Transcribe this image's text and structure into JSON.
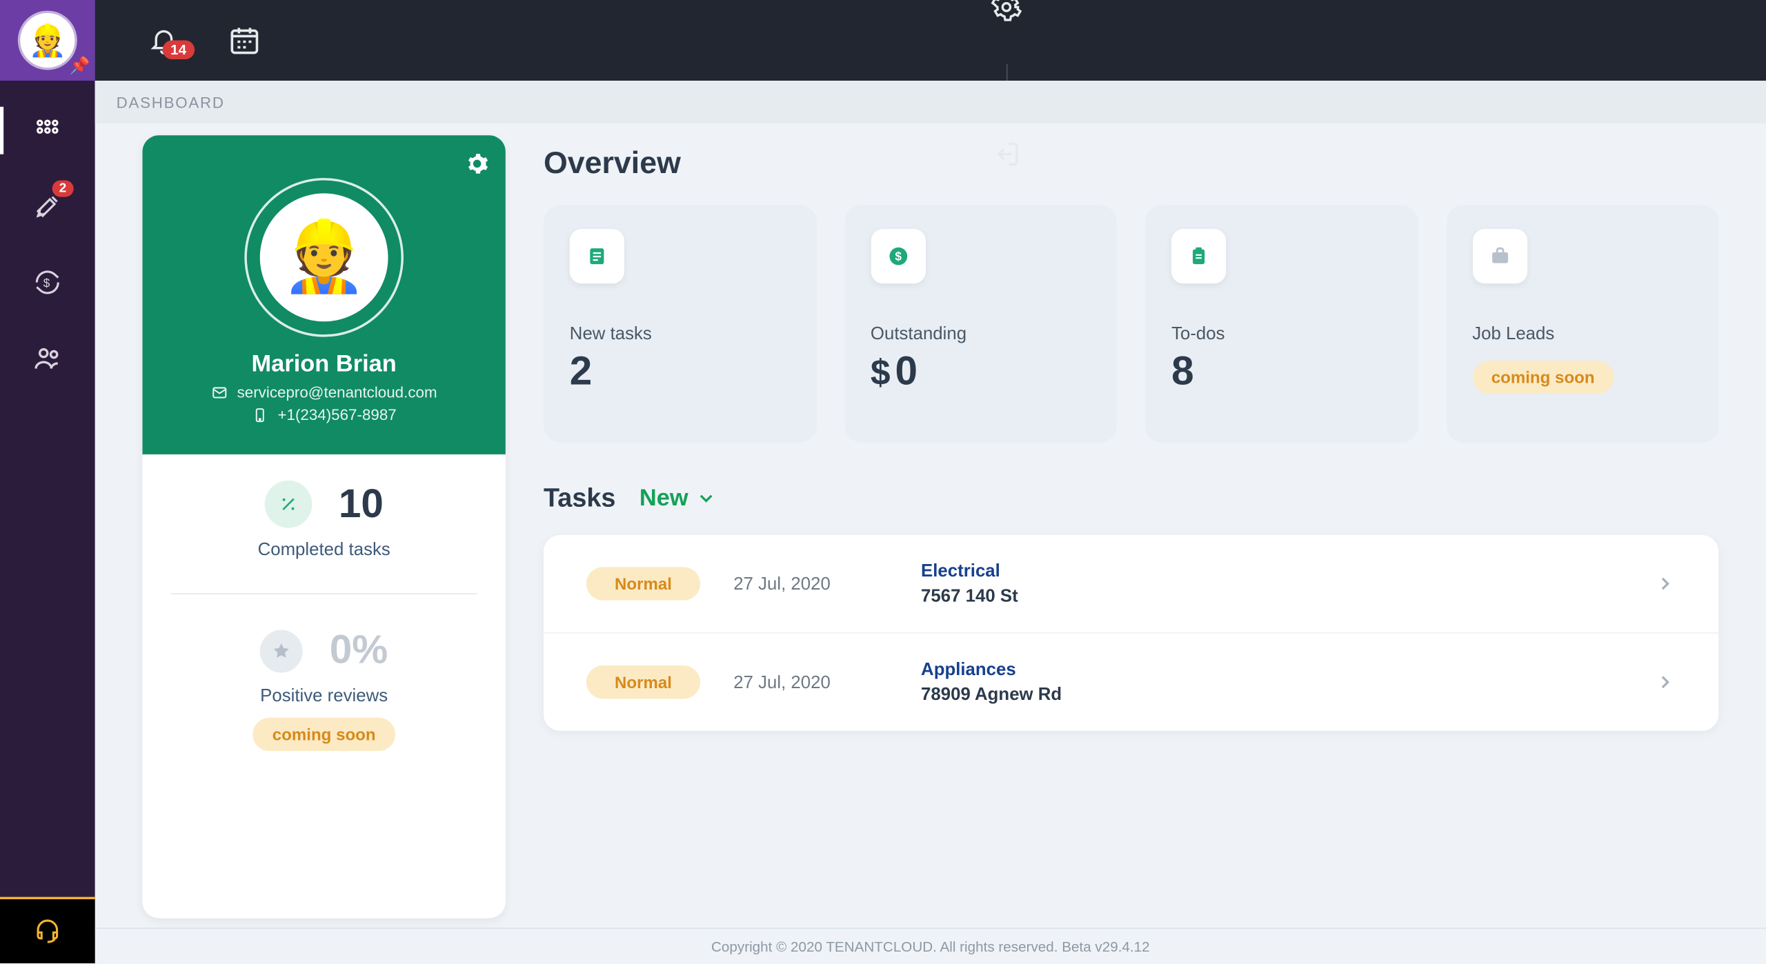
{
  "breadcrumb": "DASHBOARD",
  "header": {
    "notification_count": "14"
  },
  "side_nav": {
    "tools_badge": "2"
  },
  "profile": {
    "name": "Marion Brian",
    "email": "servicepro@tenantcloud.com",
    "phone": "+1(234)567-8987",
    "completed_count": "10",
    "completed_label": "Completed tasks",
    "reviews_percent": "0%",
    "reviews_label": "Positive reviews",
    "reviews_soon": "coming soon"
  },
  "overview": {
    "title": "Overview",
    "cards": [
      {
        "label": "New tasks",
        "value": "2",
        "icon": "note-icon"
      },
      {
        "label": "Outstanding",
        "value": "0",
        "prefix": "$",
        "icon": "dollar-icon"
      },
      {
        "label": "To-dos",
        "value": "8",
        "icon": "clipboard-icon"
      },
      {
        "label": "Job Leads",
        "value": "",
        "soon": "coming soon",
        "icon": "briefcase-icon",
        "disabled": true
      }
    ]
  },
  "tasks": {
    "title": "Tasks",
    "filter": "New",
    "items": [
      {
        "priority": "Normal",
        "date": "27 Jul, 2020",
        "category": "Electrical",
        "address": "7567 140 St"
      },
      {
        "priority": "Normal",
        "date": "27 Jul, 2020",
        "category": "Appliances",
        "address": "78909 Agnew Rd"
      }
    ]
  },
  "footer": "Copyright © 2020 TENANTCLOUD. All rights reserved. Beta v29.4.12"
}
